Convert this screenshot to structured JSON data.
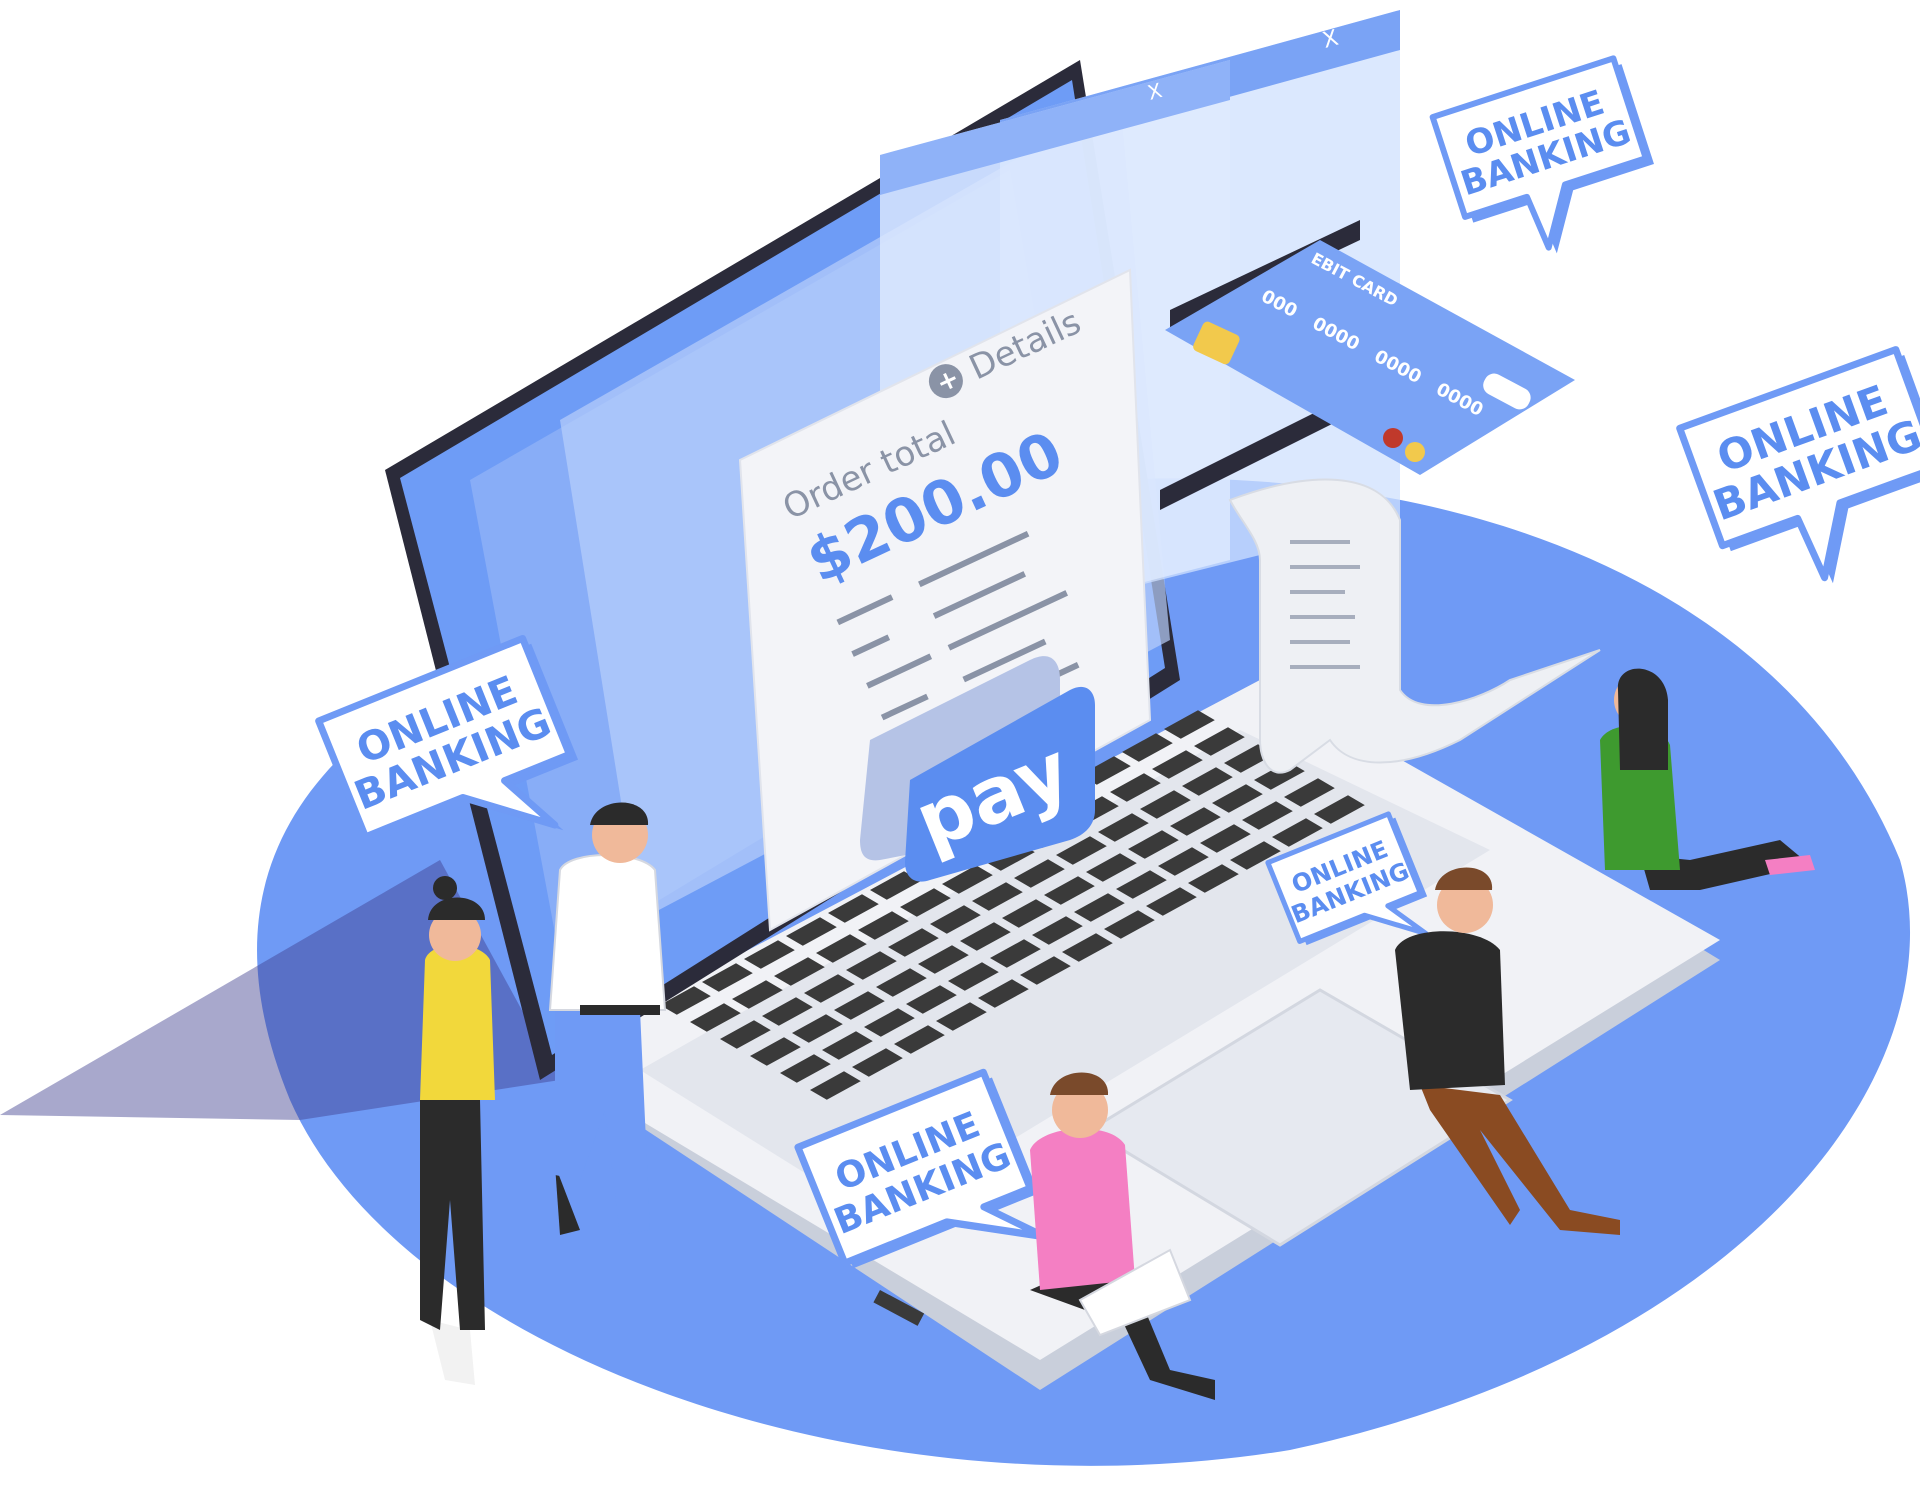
{
  "receipt": {
    "order_label": "Order total",
    "amount": "$200.00",
    "details_label": "Details"
  },
  "pay_button": {
    "label": "pay"
  },
  "card": {
    "type_label": "EBIT CARD",
    "number_groups": [
      "000",
      "0000",
      "0000",
      "0000"
    ]
  },
  "bubbles": {
    "line1": "ONLINE",
    "line2": "BANKING"
  },
  "window_controls": [
    "_",
    "□",
    "X"
  ],
  "colors": {
    "accent": "#5b8df0",
    "platform": "#6f9af5",
    "platform_dark": "#4a6fd6",
    "screen": "#6e9cf6",
    "card": "#7aa3f5",
    "shadow": "#3f3f8f"
  }
}
